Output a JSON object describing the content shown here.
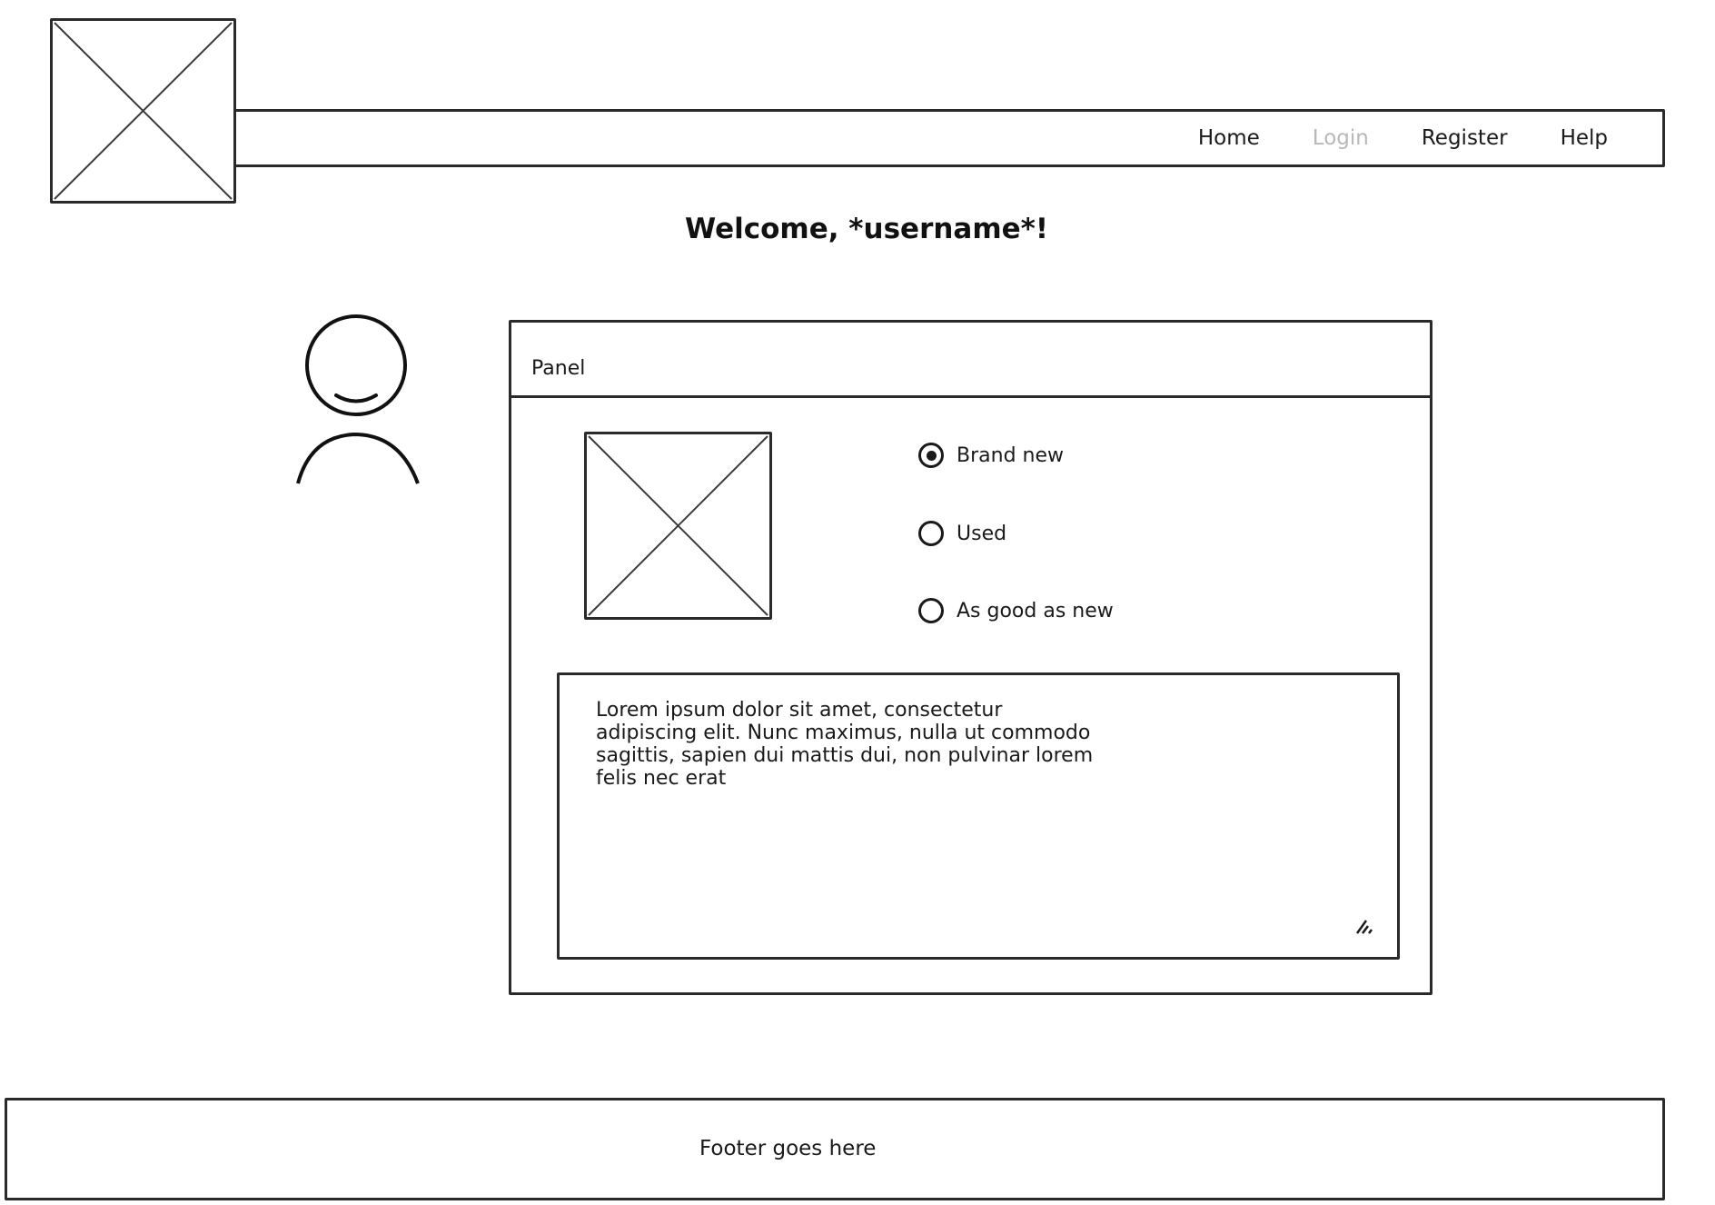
{
  "nav": {
    "items": [
      {
        "label": "Home",
        "state": "normal"
      },
      {
        "label": "Login",
        "state": "disabled"
      },
      {
        "label": "Register",
        "state": "normal"
      },
      {
        "label": "Help",
        "state": "normal"
      }
    ]
  },
  "welcome": {
    "title": "Welcome, *username*!"
  },
  "panel": {
    "title": "Panel",
    "options": [
      {
        "label": "Brand new",
        "selected": true
      },
      {
        "label": "Used",
        "selected": false
      },
      {
        "label": "As good as new",
        "selected": false
      }
    ],
    "textarea_text": "Lorem ipsum dolor sit amet, consectetur adipiscing elit. Nunc maximus, nulla ut commodo sagittis, sapien dui mattis dui, non pulvinar lorem felis nec erat"
  },
  "footer": {
    "text": "Footer goes here"
  },
  "icons": {
    "logo": "image-placeholder-icon",
    "user": "user-avatar-icon",
    "panel_image": "image-placeholder-icon",
    "resize": "resize-handle-icon"
  }
}
